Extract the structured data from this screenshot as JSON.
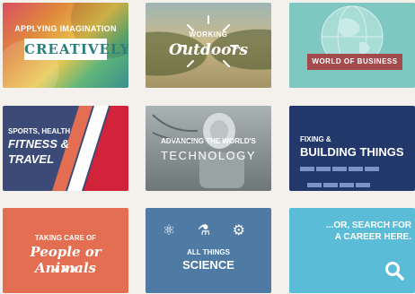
{
  "tiles": [
    {
      "key": "t1",
      "line1": "APPLYING IMAGINATION",
      "line2": "CREATIVELY",
      "icon": "banner"
    },
    {
      "key": "t2",
      "line1": "WORKING",
      "line2": "Outdoors",
      "icon": "sun-rays-icon"
    },
    {
      "key": "t3",
      "line1": "WORLD OF BUSINESS",
      "icon": "globe-icon"
    },
    {
      "key": "t4",
      "line1": "SPORTS, HEALTH",
      "line2": "FITNESS &",
      "line3": "TRAVEL"
    },
    {
      "key": "t5",
      "line1": "ADVANCING THE WORLD'S",
      "line2": "TECHNOLOGY"
    },
    {
      "key": "t6",
      "line1": "FIXING &",
      "line2": "BUILDING THINGS",
      "icon": "bricks-icon"
    },
    {
      "key": "t7",
      "line1": "TAKING CARE OF",
      "line2": "People or Animals",
      "icons": "♣  ♥  ❦"
    },
    {
      "key": "t8",
      "line1": "ALL THINGS",
      "line2": "SCIENCE",
      "icons": "⚛ ⚗ ⚙"
    },
    {
      "key": "t9",
      "line1": "...OR, SEARCH FOR",
      "line2": "A CAREER HERE.",
      "icon": "search-icon"
    }
  ],
  "colors": {
    "t3": "#7fc7c1",
    "t4": "#3c4a78",
    "t6": "#23386a",
    "t7": "#e36e52",
    "t8": "#4e7aa3",
    "t9": "#5bbcd7"
  }
}
